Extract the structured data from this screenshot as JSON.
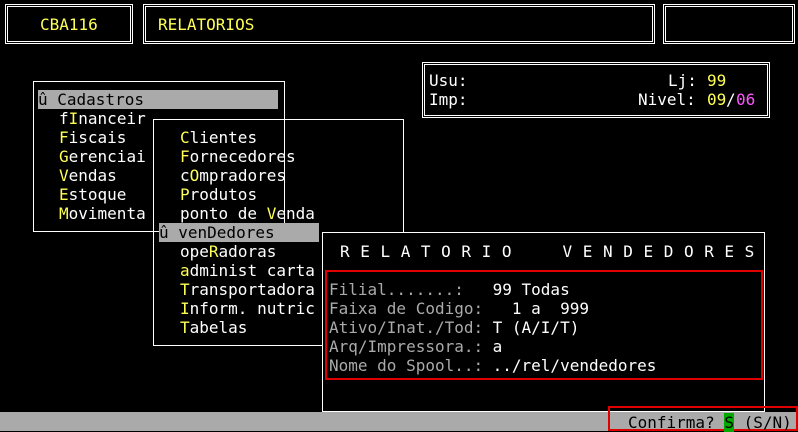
{
  "header": {
    "code": "CBA116",
    "title": "RELATORIOS",
    "right_box": ""
  },
  "info": {
    "usu_label": "Usu:",
    "usu_value": "",
    "lj_label": "Lj:",
    "lj_value": "99",
    "imp_label": "Imp:",
    "imp_value": "",
    "nivel_label": "Nivel:",
    "nivel_value": "09",
    "nivel_sep": "/",
    "nivel_max": "06"
  },
  "main_menu": {
    "items": [
      {
        "prefix": "û ",
        "hot": "C",
        "rest": "adastros",
        "selected": true
      },
      {
        "prefix": "",
        "pre": "f",
        "hot": "I",
        "rest": "nanceir"
      },
      {
        "prefix": "",
        "hot": "F",
        "rest": "iscais"
      },
      {
        "prefix": "",
        "hot": "G",
        "rest": "erenciai"
      },
      {
        "prefix": "",
        "hot": "V",
        "rest": "endas"
      },
      {
        "prefix": "",
        "hot": "E",
        "rest": "stoque"
      },
      {
        "prefix": "",
        "hot": "M",
        "rest": "ovimenta"
      }
    ]
  },
  "sub_menu": {
    "items": [
      {
        "pre": "",
        "hot": "C",
        "rest": "lientes"
      },
      {
        "pre": "",
        "hot": "F",
        "rest": "ornecedores"
      },
      {
        "pre": "c",
        "hot": "O",
        "rest": "mpradores"
      },
      {
        "pre": "",
        "hot": "P",
        "rest": "rodutos"
      },
      {
        "pre": "ponto de ",
        "hot": "V",
        "rest": "enda"
      },
      {
        "pre": "û ven",
        "hot": "D",
        "rest": "edores",
        "selected": true
      },
      {
        "pre": "ope",
        "hot": "R",
        "rest": "adoras"
      },
      {
        "pre": "",
        "hot": "a",
        "rest": "dminist carta"
      },
      {
        "pre": "",
        "hot": "T",
        "rest": "ransportadora"
      },
      {
        "pre": "",
        "hot": "I",
        "rest": "nform. nutric"
      },
      {
        "pre": "",
        "hot": "T",
        "rest": "abelas"
      }
    ]
  },
  "report": {
    "title": "RELATORIO  VENDEDORES",
    "fields": [
      {
        "label": "Filial.......:",
        "value": " 99 Todas"
      },
      {
        "label": "Faixa de Codigo:",
        "value": "   1 a  999"
      },
      {
        "label": "Ativo/Inat./Tod:",
        "value": " T (A/I/T)"
      },
      {
        "label": "Arq/Impressora.:",
        "value": " a"
      },
      {
        "label": "Nome do Spool..:",
        "value": " ../rel/vendedores"
      }
    ]
  },
  "status": {
    "confirm_label": "Confirma? ",
    "confirm_value": "S",
    "confirm_options": " (S/N)"
  }
}
